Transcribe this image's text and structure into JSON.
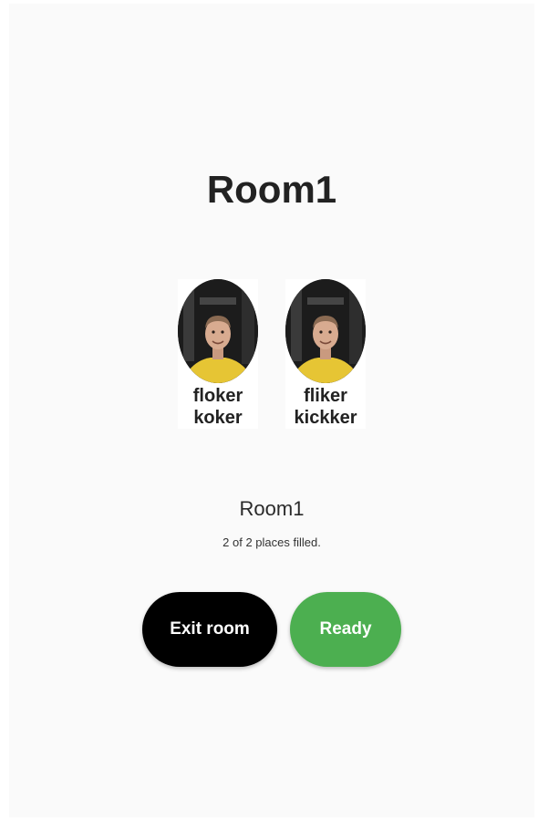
{
  "room": {
    "title": "Room1",
    "name": "Room1",
    "places_text": "2 of 2 places filled."
  },
  "players": [
    {
      "name": "floker koker",
      "avatar": "person-photo"
    },
    {
      "name": "fliker kickker",
      "avatar": "person-photo"
    }
  ],
  "actions": {
    "exit_label": "Exit room",
    "ready_label": "Ready"
  },
  "colors": {
    "background": "#fafafa",
    "exit_button": "#000000",
    "ready_button": "#4caf50",
    "text": "#222222"
  }
}
